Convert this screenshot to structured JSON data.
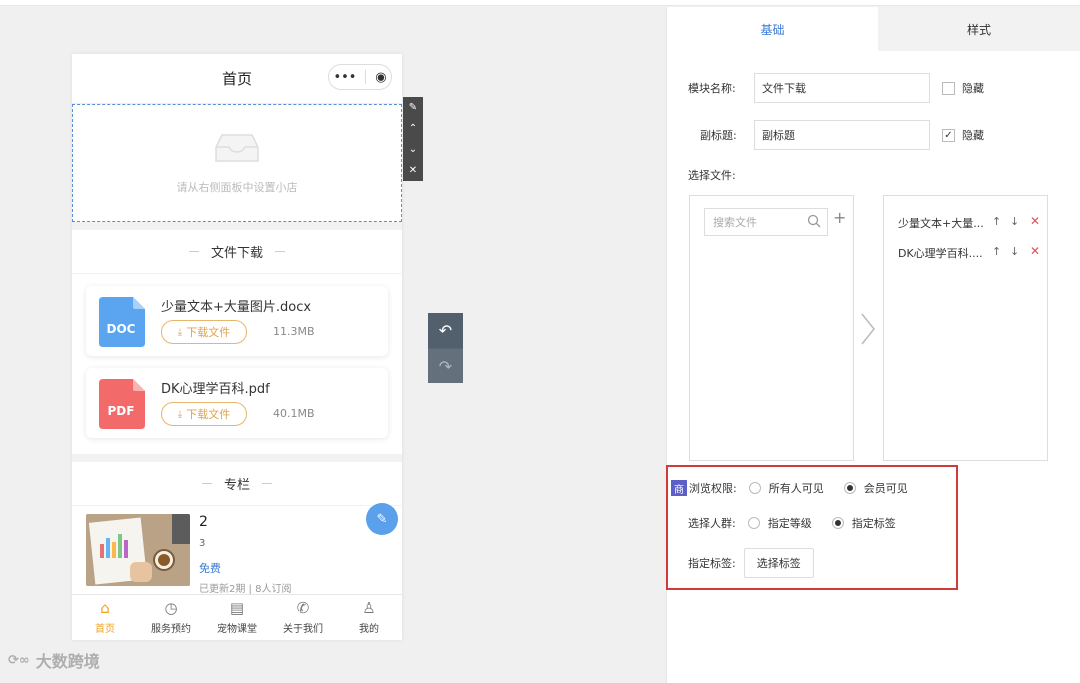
{
  "phone": {
    "title": "首页",
    "capsule_more": "•••",
    "capsule_target": "◉",
    "store_placeholder": "请从右侧面板中设置小店",
    "file_section_title": "文件下载",
    "files": [
      {
        "name": "少量文本+大量图片.docx",
        "icon_label": "DOC",
        "download_label": "下载文件",
        "size": "11.3MB",
        "color": "#5ba4f0"
      },
      {
        "name": "DK心理学百科.pdf",
        "icon_label": "PDF",
        "download_label": "下载文件",
        "size": "40.1MB",
        "color": "#f26a6a"
      }
    ],
    "column_section_title": "专栏",
    "column_item": {
      "title": "2",
      "subtitle": "3",
      "price": "免费",
      "update": "已更新2期 | 8人订阅"
    },
    "tabs": [
      {
        "label": "首页",
        "icon": "home-icon",
        "glyph": "⌂",
        "active": true
      },
      {
        "label": "服务预约",
        "icon": "clock-icon",
        "glyph": "◷",
        "active": false
      },
      {
        "label": "宠物课堂",
        "icon": "document-icon",
        "glyph": "▤",
        "active": false
      },
      {
        "label": "关于我们",
        "icon": "phone-icon",
        "glyph": "✆",
        "active": false
      },
      {
        "label": "我的",
        "icon": "user-icon",
        "glyph": "♙",
        "active": false
      }
    ]
  },
  "tools": {
    "edit": "✎",
    "up": "⌃",
    "down": "⌄",
    "close": "✕",
    "undo": "↶",
    "redo": "↷"
  },
  "panel": {
    "tab_basic": "基础",
    "tab_style": "样式",
    "module_name_label": "模块名称:",
    "module_name_value": "文件下载",
    "hide_label_1": "隐藏",
    "hide_1_checked": false,
    "subtitle_label": "副标题:",
    "subtitle_value": "副标题",
    "hide_label_2": "隐藏",
    "hide_2_checked": true,
    "select_file_label": "选择文件:",
    "search_placeholder": "搜索文件",
    "selected_files": [
      "少量文本+大量...",
      "DK心理学百科...."
    ],
    "permission": {
      "badge": "商",
      "label": "浏览权限:",
      "options": [
        "所有人可见",
        "会员可见"
      ],
      "selected": 1
    },
    "crowd": {
      "label": "选择人群:",
      "options": [
        "指定等级",
        "指定标签"
      ],
      "selected": 1
    },
    "tag": {
      "label": "指定标签:",
      "button": "选择标签"
    }
  },
  "watermark": "大数跨境",
  "colors": {
    "accent": "#3a7bd5",
    "highlight_border": "#d03a3a",
    "tab_active": "#f0a020",
    "download_orange": "#e0a24a"
  }
}
